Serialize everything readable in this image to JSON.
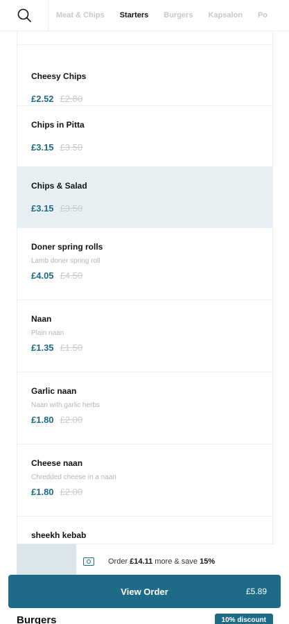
{
  "header": {
    "tabs": [
      {
        "label": "Meat & Chips",
        "active": false
      },
      {
        "label": "Starters",
        "active": true
      },
      {
        "label": "Burgers",
        "active": false
      },
      {
        "label": "Kapsalon",
        "active": false
      },
      {
        "label": "Po",
        "active": false
      }
    ],
    "search_icon": "search-icon"
  },
  "items": [
    {
      "name": "Cheesy Chips",
      "desc": "",
      "price": "£2.52",
      "old_price": "£2.80",
      "highlight": false
    },
    {
      "name": "Chips in Pitta",
      "desc": "",
      "price": "£3.15",
      "old_price": "£3.50",
      "highlight": false
    },
    {
      "name": "Chips & Salad",
      "desc": "",
      "price": "£3.15",
      "old_price": "£3.50",
      "highlight": true
    },
    {
      "name": "Doner spring rolls",
      "desc": "Lamb doner spring roll",
      "price": "£4.05",
      "old_price": "£4.50",
      "highlight": false
    },
    {
      "name": "Naan",
      "desc": "Plain naan",
      "price": "£1.35",
      "old_price": "£1.50",
      "highlight": false
    },
    {
      "name": "Garlic naan",
      "desc": "Naan with garlic herbs",
      "price": "£1.80",
      "old_price": "£2.00",
      "highlight": false
    },
    {
      "name": "Cheese naan",
      "desc": "Chredded cheese in a naan",
      "price": "£1.80",
      "old_price": "£2.00",
      "highlight": false
    },
    {
      "name": "sheekh kebab",
      "desc": "",
      "price": "",
      "old_price": "",
      "highlight": false
    }
  ],
  "promo": {
    "prefix": "Order ",
    "amount": "£14.11",
    "middle": " more & save ",
    "percent": "15%",
    "icon": "discount-ticket-icon"
  },
  "order_button": {
    "label": "View Order",
    "total": "£5.89"
  },
  "next_section": {
    "title": "Burgers",
    "badge": "10% discount"
  },
  "colors": {
    "accent": "#1d6b87",
    "price": "#1e6a88",
    "highlight_bg": "#e8eff3"
  }
}
